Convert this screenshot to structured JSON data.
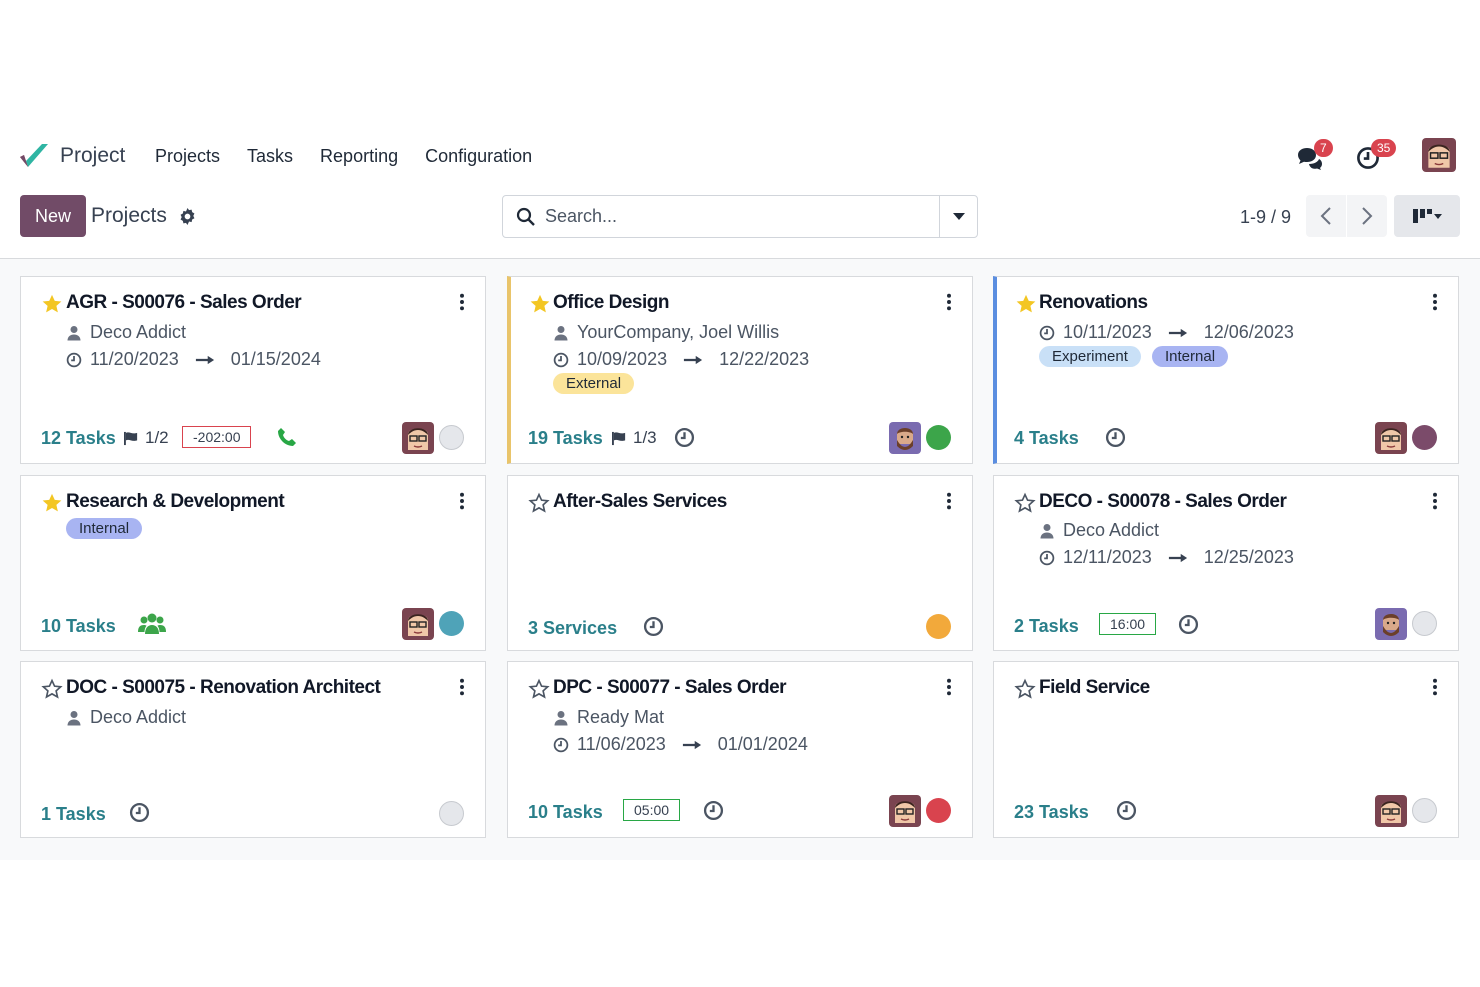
{
  "app": {
    "name": "Project"
  },
  "menu": [
    "Projects",
    "Tasks",
    "Reporting",
    "Configuration"
  ],
  "systray": {
    "messages_count": "7",
    "activities_count": "35"
  },
  "control": {
    "new_label": "New",
    "breadcrumb": "Projects",
    "search_placeholder": "Search...",
    "pager": "1-9 / 9"
  },
  "colors": {
    "brand": "#714b67",
    "link": "#2a7f8a",
    "favorite": "#f3c623"
  },
  "cards": [
    {
      "title": "AGR - S00076 - Sales Order",
      "favorite": true,
      "customer": "Deco Addict",
      "date_start": "11/20/2023",
      "date_end": "01/15/2024",
      "tasks": "12 Tasks",
      "milestones": "1/2",
      "hours": "-202:00",
      "status": "grey"
    },
    {
      "title": "Office Design",
      "favorite": true,
      "customer": "YourCompany, Joel Willis",
      "date_start": "10/09/2023",
      "date_end": "12/22/2023",
      "tags": [
        "External"
      ],
      "tasks": "19 Tasks",
      "milestones": "1/3",
      "status": "green"
    },
    {
      "title": "Renovations",
      "favorite": true,
      "date_start": "10/11/2023",
      "date_end": "12/06/2023",
      "tags": [
        "Experiment",
        "Internal"
      ],
      "tasks": "4 Tasks",
      "status": "purple"
    },
    {
      "title": "Research & Development",
      "favorite": true,
      "tags": [
        "Internal"
      ],
      "tasks": "10 Tasks",
      "status": "teal"
    },
    {
      "title": "After-Sales Services",
      "favorite": false,
      "tasks": "3 Services",
      "status": "orange"
    },
    {
      "title": "DECO - S00078 - Sales Order",
      "favorite": false,
      "customer": "Deco Addict",
      "date_start": "12/11/2023",
      "date_end": "12/25/2023",
      "tasks": "2 Tasks",
      "hours": "16:00",
      "status": "grey"
    },
    {
      "title": "DOC - S00075 - Renovation Architect",
      "favorite": false,
      "customer": "Deco Addict",
      "tasks": "1 Tasks",
      "status": "grey"
    },
    {
      "title": "DPC - S00077 - Sales Order",
      "favorite": false,
      "customer": "Ready Mat",
      "date_start": "11/06/2023",
      "date_end": "01/01/2024",
      "tasks": "10 Tasks",
      "hours": "05:00",
      "status": "red"
    },
    {
      "title": "Field Service",
      "favorite": false,
      "tasks": "23 Tasks",
      "status": "grey"
    }
  ]
}
